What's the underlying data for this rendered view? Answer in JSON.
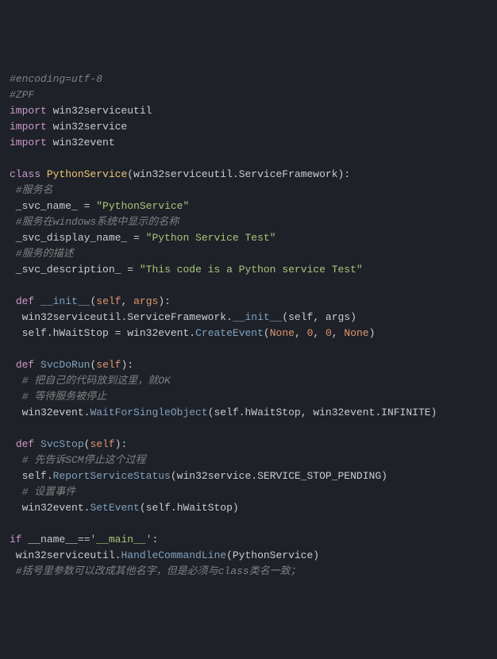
{
  "code": {
    "l1": "#encoding=utf-8",
    "l2": "#ZPF",
    "l3a": "import",
    "l3b": " win32serviceutil",
    "l4a": "import",
    "l4b": " win32service",
    "l5a": "import",
    "l5b": " win32event",
    "l6": "",
    "l7a": "class",
    "l7b": " ",
    "l7c": "PythonService",
    "l7d": "(win32serviceutil",
    "l7e": ".",
    "l7f": "ServiceFramework",
    "l7g": "):",
    "l8": " #服务名",
    "l9a": " _svc_name_ ",
    "l9b": "=",
    "l9c": " ",
    "l9d": "\"PythonService\"",
    "l10": " #服务在windows系统中显示的名称",
    "l11a": " _svc_display_name_ ",
    "l11b": "=",
    "l11c": " ",
    "l11d": "\"Python Service Test\"",
    "l12": " #服务的描述",
    "l13a": " _svc_description_ ",
    "l13b": "=",
    "l13c": " ",
    "l13d": "\"This code is a Python service Test\"",
    "l14": "",
    "l15a": " ",
    "l15b": "def",
    "l15c": " ",
    "l15d": "__init__",
    "l15e": "(",
    "l15f": "self",
    "l15g": ", ",
    "l15h": "args",
    "l15i": "):",
    "l16a": "  win32serviceutil",
    "l16b": ".",
    "l16c": "ServiceFramework",
    "l16d": ".",
    "l16e": "__init__",
    "l16f": "(self, args)",
    "l17a": "  self",
    "l17b": ".",
    "l17c": "hWaitStop ",
    "l17d": "=",
    "l17e": " win32event",
    "l17f": ".",
    "l17g": "CreateEvent",
    "l17h": "(",
    "l17i": "None",
    "l17j": ", ",
    "l17k": "0",
    "l17l": ", ",
    "l17m": "0",
    "l17n": ", ",
    "l17o": "None",
    "l17p": ")",
    "l18": "",
    "l19a": " ",
    "l19b": "def",
    "l19c": " ",
    "l19d": "SvcDoRun",
    "l19e": "(",
    "l19f": "self",
    "l19g": "):",
    "l20": "  # 把自己的代码放到这里，就OK",
    "l21": "  # 等待服务被停止",
    "l22a": "  win32event",
    "l22b": ".",
    "l22c": "WaitForSingleObject",
    "l22d": "(self",
    "l22e": ".",
    "l22f": "hWaitStop, win32event",
    "l22g": ".",
    "l22h": "INFINITE)",
    "l23": "",
    "l24a": " ",
    "l24b": "def",
    "l24c": " ",
    "l24d": "SvcStop",
    "l24e": "(",
    "l24f": "self",
    "l24g": "):",
    "l25": "  # 先告诉SCM停止这个过程",
    "l26a": "  self",
    "l26b": ".",
    "l26c": "ReportServiceStatus",
    "l26d": "(win32service",
    "l26e": ".",
    "l26f": "SERVICE_STOP_PENDING)",
    "l27": "  # 设置事件",
    "l28a": "  win32event",
    "l28b": ".",
    "l28c": "SetEvent",
    "l28d": "(self",
    "l28e": ".",
    "l28f": "hWaitStop)",
    "l29": "",
    "l30a": "if",
    "l30b": " __name__",
    "l30c": "==",
    "l30d": "'__main__'",
    "l30e": ":",
    "l31a": " win32serviceutil",
    "l31b": ".",
    "l31c": "HandleCommandLine",
    "l31d": "(PythonService)",
    "l32": " #括号里参数可以改成其他名字，但是必须与class类名一致；"
  }
}
